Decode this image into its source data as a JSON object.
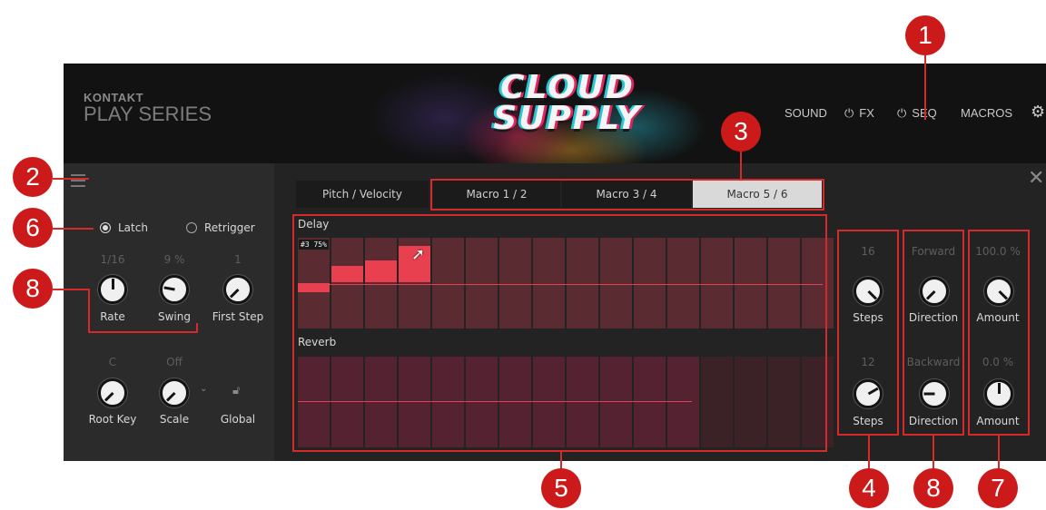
{
  "header": {
    "brand_small": "KONTAKT",
    "brand_big": "PLAY SERIES",
    "logo_line1": "CLOUD",
    "logo_line2": "SUPPLY",
    "nav": {
      "sound": "SOUND",
      "fx": "FX",
      "seq": "SEQ",
      "macros": "MACROS"
    },
    "icons": {
      "power": "power-icon",
      "settings": "gear-icon"
    }
  },
  "left": {
    "menu_icon": "hamburger-icon",
    "latch_label": "Latch",
    "retrigger_label": "Retrigger",
    "latch_selected": true,
    "rate": {
      "value": "1/16",
      "label": "Rate"
    },
    "swing": {
      "value": "9 %",
      "label": "Swing"
    },
    "first_step": {
      "value": "1",
      "label": "First Step"
    },
    "root_key": {
      "value": "C",
      "label": "Root Key"
    },
    "scale": {
      "value": "Off",
      "label": "Scale"
    },
    "global": {
      "label": "Global"
    }
  },
  "tabs": [
    "Pitch / Velocity",
    "Macro 1 / 2",
    "Macro 3 / 4",
    "Macro 5 / 6"
  ],
  "active_tab": 3,
  "lanes": {
    "delay": {
      "title": "Delay",
      "tooltip": "#3 75%",
      "steps": 16,
      "active_steps": 16
    },
    "reverb": {
      "title": "Reverb",
      "steps": 16,
      "active_steps": 12
    }
  },
  "right": {
    "steps_top": {
      "value": "16",
      "label": "Steps"
    },
    "steps_bottom": {
      "value": "12",
      "label": "Steps"
    },
    "direction_top": {
      "value": "Forward",
      "label": "Direction"
    },
    "direction_bottom": {
      "value": "Backward",
      "label": "Direction"
    },
    "amount_top": {
      "value": "100.0 %",
      "label": "Amount"
    },
    "amount_bottom": {
      "value": "0.0 %",
      "label": "Amount"
    },
    "close_icon": "close-icon"
  },
  "callouts": {
    "c1": "1",
    "c2": "2",
    "c3": "3",
    "c4": "4",
    "c5": "5",
    "c6": "6",
    "c7": "7",
    "c8a": "8",
    "c8b": "8"
  },
  "colors": {
    "callout": "#cc1a1a",
    "step": "#5a2b30",
    "step_active": "#e8404f",
    "accent_line": "#e04055"
  }
}
